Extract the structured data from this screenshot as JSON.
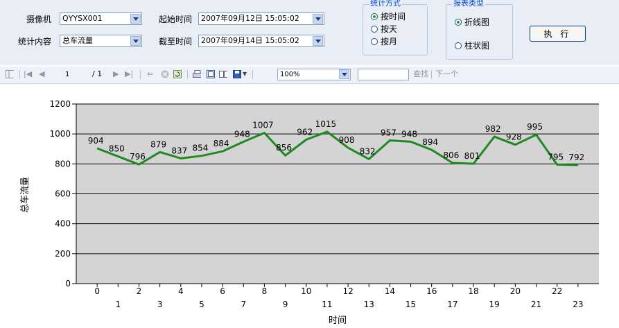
{
  "form": {
    "camera_label": "摄像机",
    "camera_value": "QYYSX001",
    "content_label": "统计内容",
    "content_value": "总车流量",
    "start_label": "起始时间",
    "start_value": "2007年09月12日 15:05:02",
    "end_label": "截至时间",
    "end_value": "2007年09月14日 15:05:02"
  },
  "stat_mode": {
    "title": "统计方式",
    "options": [
      "按时间",
      "按天",
      "按月"
    ],
    "selected": "按时间"
  },
  "chart_type": {
    "title": "报表类型",
    "options": [
      "折线图",
      "柱状图"
    ],
    "selected": "折线图"
  },
  "execute_label": "执 行",
  "toolbar": {
    "page_value": "1",
    "page_total": "/ 1",
    "zoom_value": "100%",
    "find_label": "查找",
    "next_label": "下一个"
  },
  "colors": {
    "line": "#1f8a1f",
    "plot_bg": "#d4d4d4",
    "panel_bg": "#e9eef6",
    "accent": "#0046d5"
  },
  "chart_data": {
    "type": "line",
    "xlabel": "时间",
    "ylabel": "总车流量",
    "x": [
      0,
      1,
      2,
      3,
      4,
      5,
      6,
      7,
      8,
      9,
      10,
      11,
      12,
      13,
      14,
      15,
      16,
      17,
      18,
      19,
      20,
      21,
      22,
      23
    ],
    "values": [
      904,
      850,
      796,
      879,
      837,
      854,
      884,
      948,
      1007,
      856,
      962,
      1015,
      908,
      832,
      957,
      948,
      894,
      806,
      801,
      982,
      928,
      995,
      795,
      792
    ],
    "ylim": [
      0,
      1200
    ],
    "yticks": [
      0,
      200,
      400,
      600,
      800,
      1000,
      1200
    ],
    "grid": "horizontal",
    "legend": "none"
  }
}
